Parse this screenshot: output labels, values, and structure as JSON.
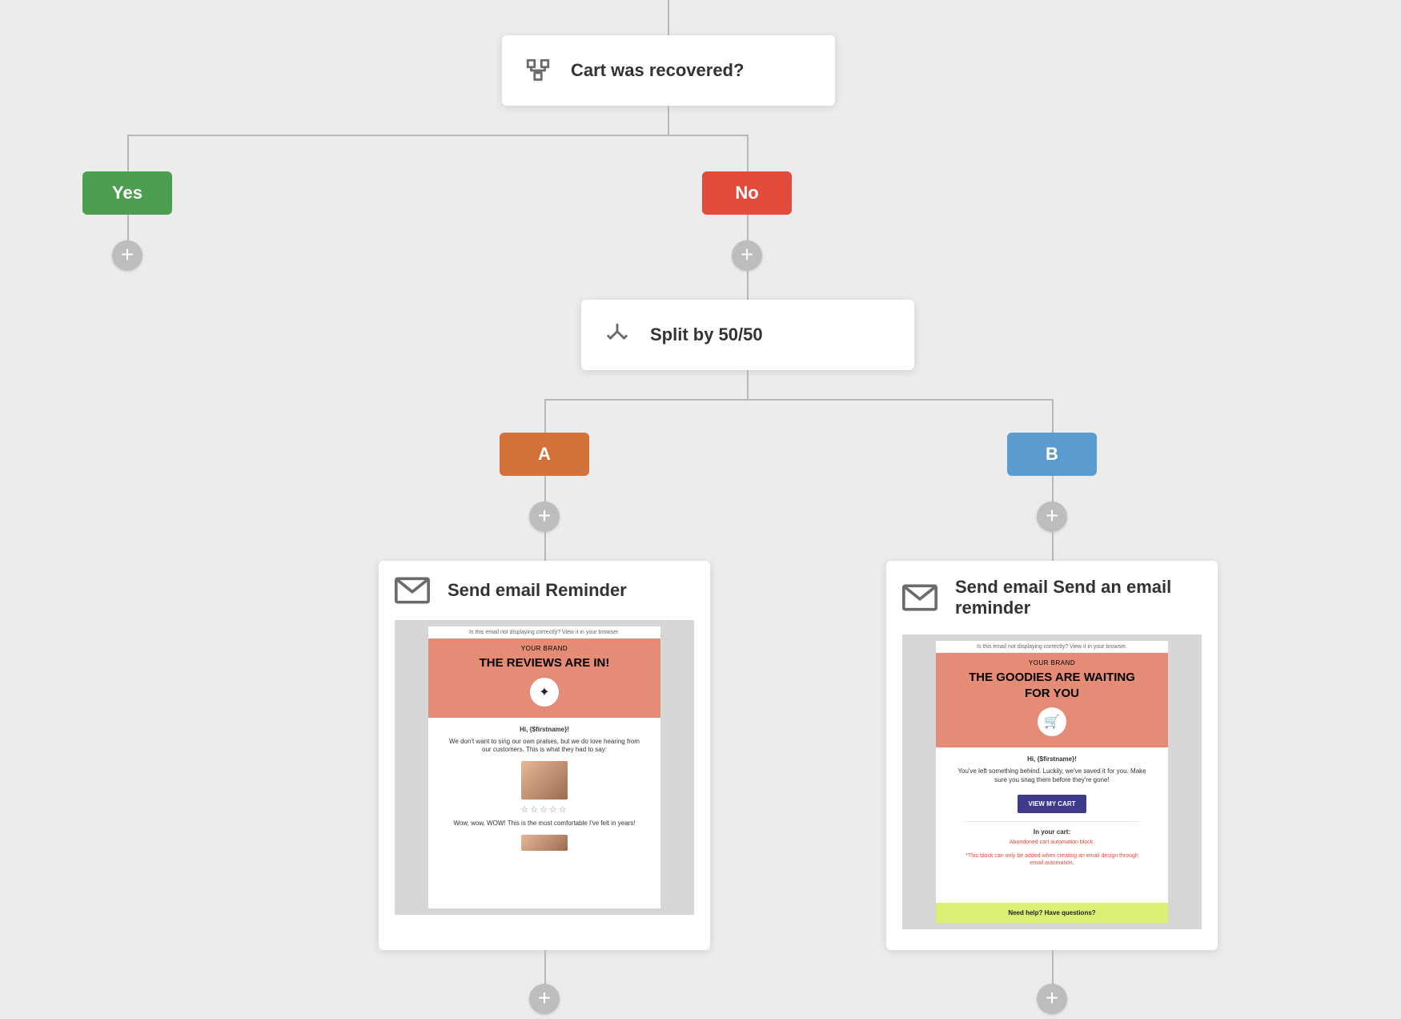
{
  "condition": {
    "label": "Cart was recovered?"
  },
  "branches": {
    "yes": "Yes",
    "no": "No"
  },
  "split": {
    "label": "Split by 50/50"
  },
  "variants": {
    "a": "A",
    "b": "B"
  },
  "emailA": {
    "title": "Send email Reminder",
    "preview": {
      "tagline": "Is this email not displaying correctly? View it in your browser.",
      "brand": "YOUR BRAND",
      "headline": "THE REVIEWS ARE IN!",
      "hi": "Hi, {$firstname}!",
      "para": "We don't want to sing our own praises, but we do love hearing from our customers. This is what they had to say:",
      "quote": "Wow, wow, WOW! This is the most comfortable I've felt in years!"
    }
  },
  "emailB": {
    "title": "Send email Send an email reminder",
    "preview": {
      "tagline": "Is this email not displaying correctly? View it in your browser.",
      "brand": "YOUR BRAND",
      "headline": "THE GOODIES ARE WAITING FOR YOU",
      "hi": "Hi, {$firstname}!",
      "para": "You've left something behind. Luckily, we've saved it for you. Make sure you snag them before they're gone!",
      "cta": "VIEW MY CART",
      "sec": "In your cart:",
      "warn1": "Abandoned cart automation block.",
      "warn2": "*This block can only be added when creating an email design through email automation.",
      "help": "Need help? Have questions?"
    }
  }
}
